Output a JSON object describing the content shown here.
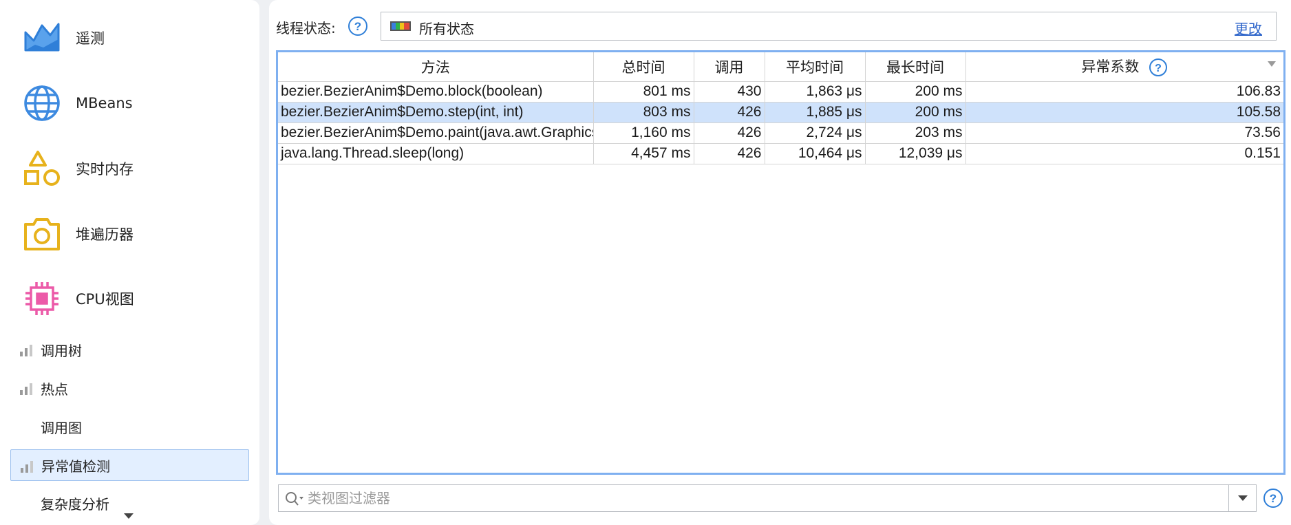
{
  "sidebar": {
    "big_items": [
      {
        "label": "遥测",
        "icon": "telemetry-icon"
      },
      {
        "label": "MBeans",
        "icon": "globe-icon"
      },
      {
        "label": "实时内存",
        "icon": "shapes-icon"
      },
      {
        "label": "堆遍历器",
        "icon": "camera-icon"
      },
      {
        "label": "CPU视图",
        "icon": "cpu-chip-icon"
      }
    ],
    "small_items": [
      {
        "label": "调用树",
        "icon": "bar-chart-icon"
      },
      {
        "label": "热点",
        "icon": "bar-chart-icon"
      },
      {
        "label": "调用图",
        "icon": ""
      },
      {
        "label": "异常值检测",
        "icon": "bar-chart-icon",
        "selected": true
      },
      {
        "label": "复杂度分析",
        "icon": ""
      }
    ]
  },
  "thread_state": {
    "label": "线程状态:",
    "value": "所有状态",
    "change": "更改"
  },
  "table": {
    "columns": [
      "方法",
      "总时间",
      "调用",
      "平均时间",
      "最长时间",
      "异常系数"
    ],
    "rows": [
      {
        "method": "bezier.BezierAnim$Demo.block(boolean)",
        "total": "801 ms",
        "calls": "430",
        "avg": "1,863 μs",
        "max": "200 ms",
        "coef": "106.83",
        "selected": false
      },
      {
        "method": "bezier.BezierAnim$Demo.step(int, int)",
        "total": "803 ms",
        "calls": "426",
        "avg": "1,885 μs",
        "max": "200 ms",
        "coef": "105.58",
        "selected": true
      },
      {
        "method": "bezier.BezierAnim$Demo.paint(java.awt.Graphics)",
        "total": "1,160 ms",
        "calls": "426",
        "avg": "2,724 μs",
        "max": "203 ms",
        "coef": "73.56",
        "selected": false
      },
      {
        "method": "java.lang.Thread.sleep(long)",
        "total": "4,457 ms",
        "calls": "426",
        "avg": "10,464 μs",
        "max": "12,039 μs",
        "coef": "0.151",
        "selected": false
      }
    ]
  },
  "filter": {
    "placeholder": "类视图过滤器"
  },
  "colors": {
    "accent": "#7fb0f0",
    "selection": "#cfe2fb",
    "link": "#2a62c9",
    "help": "#2f7fd8"
  }
}
